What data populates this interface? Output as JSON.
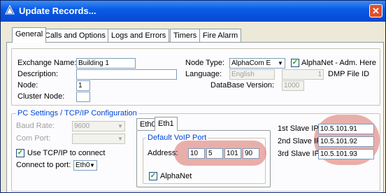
{
  "window": {
    "title": "Update Records..."
  },
  "tabs": [
    "General",
    "Calls and Options",
    "Logs and Errors",
    "Timers",
    "Fire Alarm"
  ],
  "exchange": {
    "name_label": "Exchange Name:",
    "name_value": "Building 1",
    "description_label": "Description:",
    "description_value": "",
    "node_label": "Node:",
    "node_value": "1",
    "cluster_label": "Cluster Node:",
    "cluster_value": "",
    "node_type_label": "Node Type:",
    "node_type_value": "AlphaCom E",
    "alphanet_adm_label": "AlphaNet - Adm. Here",
    "alphanet_adm_checked": true,
    "language_label": "Language:",
    "language_value": "English",
    "dmp_value": "1",
    "dmp_label": "DMP File ID",
    "db_version_label": "DataBase Version:",
    "db_version_value": "1000"
  },
  "pc_settings": {
    "legend": "PC Settings / TCP/IP Configuration",
    "baud_label": "Baud Rate:",
    "baud_value": "9600",
    "com_label": "Com Port:",
    "com_value": "",
    "use_tcp_label": "Use TCP/IP to connect",
    "use_tcp_checked": true,
    "connect_port_label": "Connect to port:",
    "connect_port_value": "Eth0"
  },
  "eth_tabs": [
    "Eth0",
    "Eth1"
  ],
  "voip": {
    "legend": "Default VoIP Port",
    "address_label": "Address:",
    "octets": [
      "10",
      "5",
      "101",
      "90"
    ],
    "alphanet_label": "AlphaNet",
    "alphanet_checked": true
  },
  "slaves": [
    {
      "label": "1st Slave IP:",
      "value": "10.5.101.91"
    },
    {
      "label": "2nd Slave IP:",
      "value": "10.5.101.92"
    },
    {
      "label": "3rd Slave IP:",
      "value": "10.5.101.93"
    }
  ],
  "colors": {
    "title_bar": "#0a5ce6",
    "highlight": "#da6e64",
    "legend_text": "#0046d5"
  },
  "icons": {
    "title": "warning-triangle-icon",
    "close": "close-icon",
    "dropdown": "chevron-down-icon",
    "check": "checkmark-icon"
  }
}
